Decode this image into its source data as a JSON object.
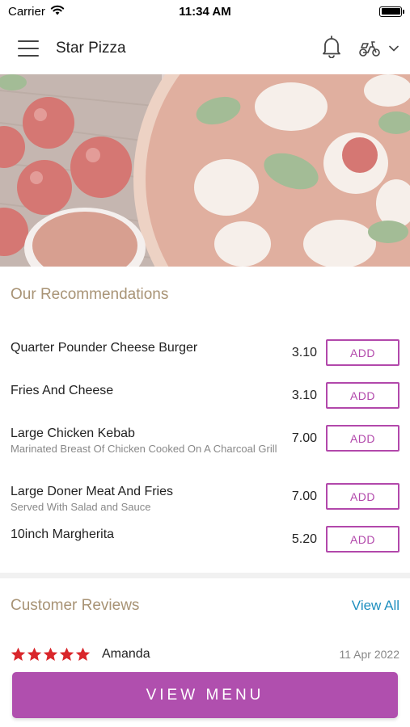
{
  "status_bar": {
    "carrier": "Carrier",
    "time": "11:34 AM"
  },
  "header": {
    "title": "Star Pizza"
  },
  "hero": {
    "image_alt": "pizza"
  },
  "recommendations": {
    "title": "Our Recommendations",
    "add_label": "ADD",
    "items": [
      {
        "name": "Quarter Pounder Cheese Burger",
        "description": "",
        "price": "3.10"
      },
      {
        "name": "Fries And Cheese",
        "description": "",
        "price": "3.10"
      },
      {
        "name": "Large Chicken Kebab",
        "description": "Marinated Breast Of Chicken Cooked On A Charcoal Grill",
        "price": "7.00"
      },
      {
        "name": "Large Doner Meat And Fries",
        "description": "Served With Salad and Sauce",
        "price": "7.00"
      },
      {
        "name": "10inch Margherita",
        "description": "",
        "price": "5.20"
      }
    ]
  },
  "reviews": {
    "title": "Customer Reviews",
    "view_all": "View All",
    "items": [
      {
        "rating": 5,
        "name": "Amanda",
        "date": "11 Apr 2022"
      }
    ]
  },
  "footer": {
    "view_menu_label": "VIEW MENU"
  },
  "colors": {
    "accent": "#b04fae",
    "section_title": "#a89375",
    "link": "#1e8fbf",
    "star": "#d9262b"
  }
}
